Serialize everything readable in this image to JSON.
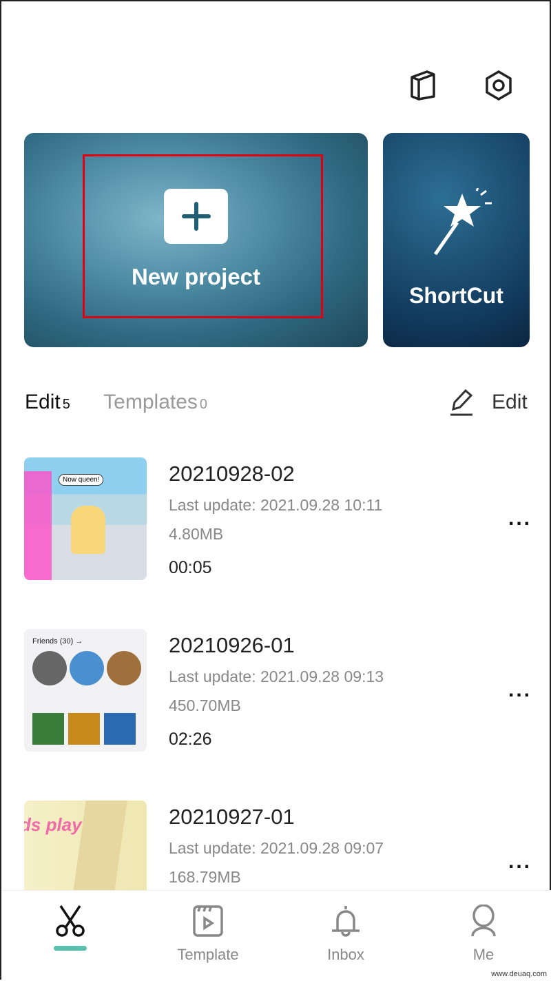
{
  "header": {
    "icons": [
      "book-icon",
      "settings-hexagon-icon"
    ]
  },
  "cards": {
    "new_project": "New project",
    "shortcut": "ShortCut"
  },
  "tabs": [
    {
      "label": "Edit",
      "count": "5",
      "active": true
    },
    {
      "label": "Templates",
      "count": "0",
      "active": false
    }
  ],
  "edit_button": "Edit",
  "projects": [
    {
      "title": "20210928-02",
      "updated": "Last update: 2021.09.28 10:11",
      "size": "4.80MB",
      "duration": "00:05",
      "thumb_text": "Now queen!"
    },
    {
      "title": "20210926-01",
      "updated": "Last update: 2021.09.28 09:13",
      "size": "450.70MB",
      "duration": "02:26",
      "thumb_text": "Friends (30) →"
    },
    {
      "title": "20210927-01",
      "updated": "Last update: 2021.09.28 09:07",
      "size": "168.79MB",
      "duration": "",
      "thumb_text": "ds play:"
    }
  ],
  "more_label": "...",
  "nav": [
    {
      "label": "",
      "icon": "scissors-icon",
      "active": true
    },
    {
      "label": "Template",
      "icon": "template-icon"
    },
    {
      "label": "Inbox",
      "icon": "bell-icon"
    },
    {
      "label": "Me",
      "icon": "person-icon"
    }
  ],
  "colors": {
    "accent": "#5bbfae",
    "highlight": "#e00010"
  },
  "watermark": "www.deuaq.com"
}
